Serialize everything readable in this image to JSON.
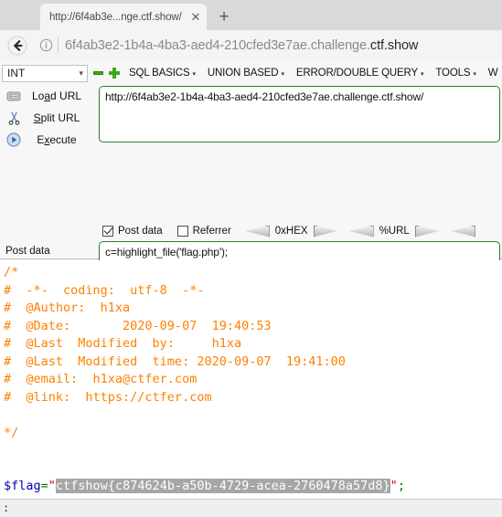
{
  "browser": {
    "tab": {
      "title": "http://6f4ab3e...nge.ctf.show/",
      "close_label": "✕"
    },
    "new_tab_label": "+",
    "back_button_name": "back",
    "url_prefix": "6f4ab3e2-1b4a-4ba3-aed4-210cfed3e7ae.challenge.",
    "url_suffix": "ctf.show"
  },
  "hackbar": {
    "type_select": {
      "value": "INT",
      "caret": "⌄"
    },
    "menus": [
      {
        "label": "SQL BASICS",
        "caret": "▾"
      },
      {
        "label": "UNION BASED",
        "caret": "▾"
      },
      {
        "label": "ERROR/DOUBLE QUERY",
        "caret": "▾"
      },
      {
        "label": "TOOLS",
        "caret": "▾"
      },
      {
        "label": "W",
        "caret": ""
      }
    ],
    "actions": [
      {
        "icon": "load-url-icon",
        "pre": "Lo",
        "key": "a",
        "post": "d URL"
      },
      {
        "icon": "split-url-icon",
        "pre": "",
        "key": "S",
        "post": "plit URL"
      },
      {
        "icon": "execute-icon",
        "pre": "E",
        "key": "x",
        "post": "ecute"
      }
    ],
    "url_value": "http://6f4ab3e2-1b4a-4ba3-aed4-210cfed3e7ae.challenge.ctf.show/",
    "options": {
      "post_data_label": "Post data",
      "post_data_checked": true,
      "referrer_label": "Referrer",
      "referrer_checked": false,
      "converters": [
        "0xHEX",
        "%URL"
      ]
    },
    "post_data_label": "Post data",
    "post_data_value": "c=highlight_file('flag.php');"
  },
  "page": {
    "lines": [
      {
        "text": "/*",
        "cls": "c-comment"
      },
      {
        "text": "#  -*-  coding:  utf-8  -*-",
        "cls": "c-comment"
      },
      {
        "text": "#  @Author:  h1xa",
        "cls": "c-comment"
      },
      {
        "text": "#  @Date:       2020-09-07  19:40:53",
        "cls": "c-comment"
      },
      {
        "text": "#  @Last  Modified  by:     h1xa",
        "cls": "c-comment"
      },
      {
        "text": "#  @Last  Modified  time: 2020-09-07  19:41:00",
        "cls": "c-comment"
      },
      {
        "text": "#  @email:  h1xa@ctfer.com",
        "cls": "c-comment"
      },
      {
        "text": "#  @link:  https://ctfer.com",
        "cls": "c-comment"
      },
      {
        "text": "",
        "cls": "c-comment"
      },
      {
        "text": "*/",
        "cls": "c-comment"
      },
      {
        "text": "",
        "cls": "c-comment"
      },
      {
        "text": "",
        "cls": "c-comment"
      }
    ],
    "flag_line": {
      "var": "$flag",
      "eq": "=",
      "quote_open": "\"",
      "flag": "ctfshow{c874624b-a50b-4729-acea-2760478a57d8}",
      "quote_close": "\"",
      "semicolon": ";"
    },
    "bottom_text": ":"
  }
}
